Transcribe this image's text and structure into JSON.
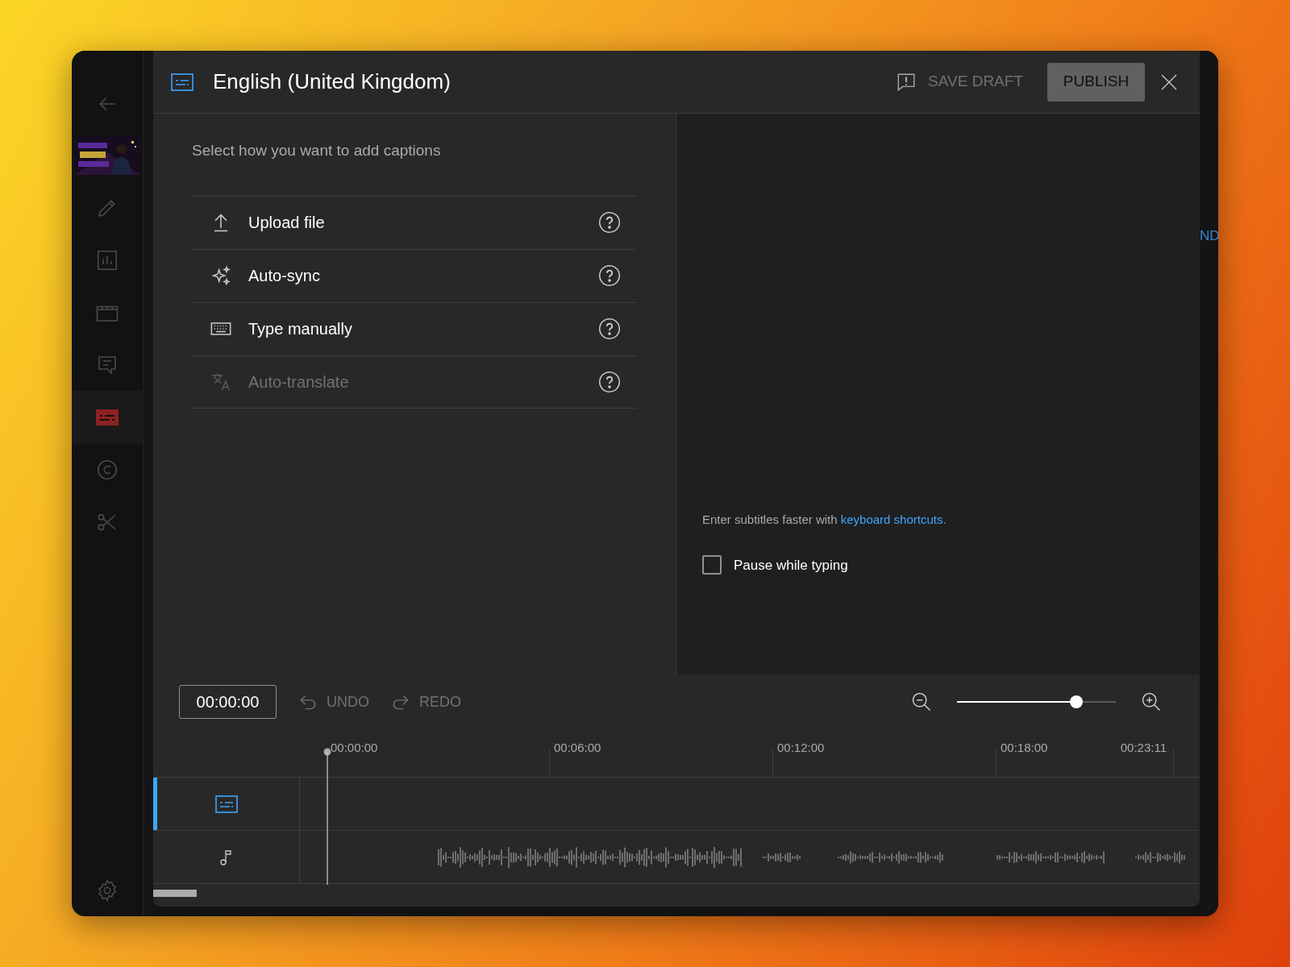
{
  "window": {
    "title": "English (United Kingdom)"
  },
  "sidebar": {
    "items": [
      {
        "selected": false
      },
      {
        "selected": false
      },
      {
        "selected": false
      },
      {
        "selected": false
      },
      {
        "selected": false
      },
      {
        "selected": true
      },
      {
        "selected": false
      },
      {
        "selected": false
      },
      {
        "selected": false
      }
    ]
  },
  "header": {
    "save_draft": "SAVE DRAFT",
    "publish": "PUBLISH"
  },
  "methods": {
    "prompt": "Select how you want to add captions",
    "options": [
      {
        "label": "Upload file",
        "disabled": false
      },
      {
        "label": "Auto-sync",
        "disabled": false
      },
      {
        "label": "Type manually",
        "disabled": false
      },
      {
        "label": "Auto-translate",
        "disabled": true
      }
    ]
  },
  "editor": {
    "hint": "Enter subtitles faster with",
    "hint_link": "keyboard shortcuts",
    "hint_end": ".",
    "pause_checkbox": {
      "label": "Pause while typing",
      "checked": false
    }
  },
  "timeline": {
    "timecode": "00:00:00",
    "undo": {
      "label": "UNDO",
      "disabled": true
    },
    "redo": {
      "label": "REDO",
      "disabled": true
    },
    "zoom": {
      "level": 0.75
    },
    "ruler": [
      "00:00:00",
      "00:06:00",
      "00:12:00",
      "00:18:00",
      "00:23:11"
    ],
    "tracks": [
      {
        "kind": "captions",
        "selected": true
      },
      {
        "kind": "audio",
        "selected": false
      }
    ]
  },
  "background_page": {
    "partial_text": "ND"
  }
}
